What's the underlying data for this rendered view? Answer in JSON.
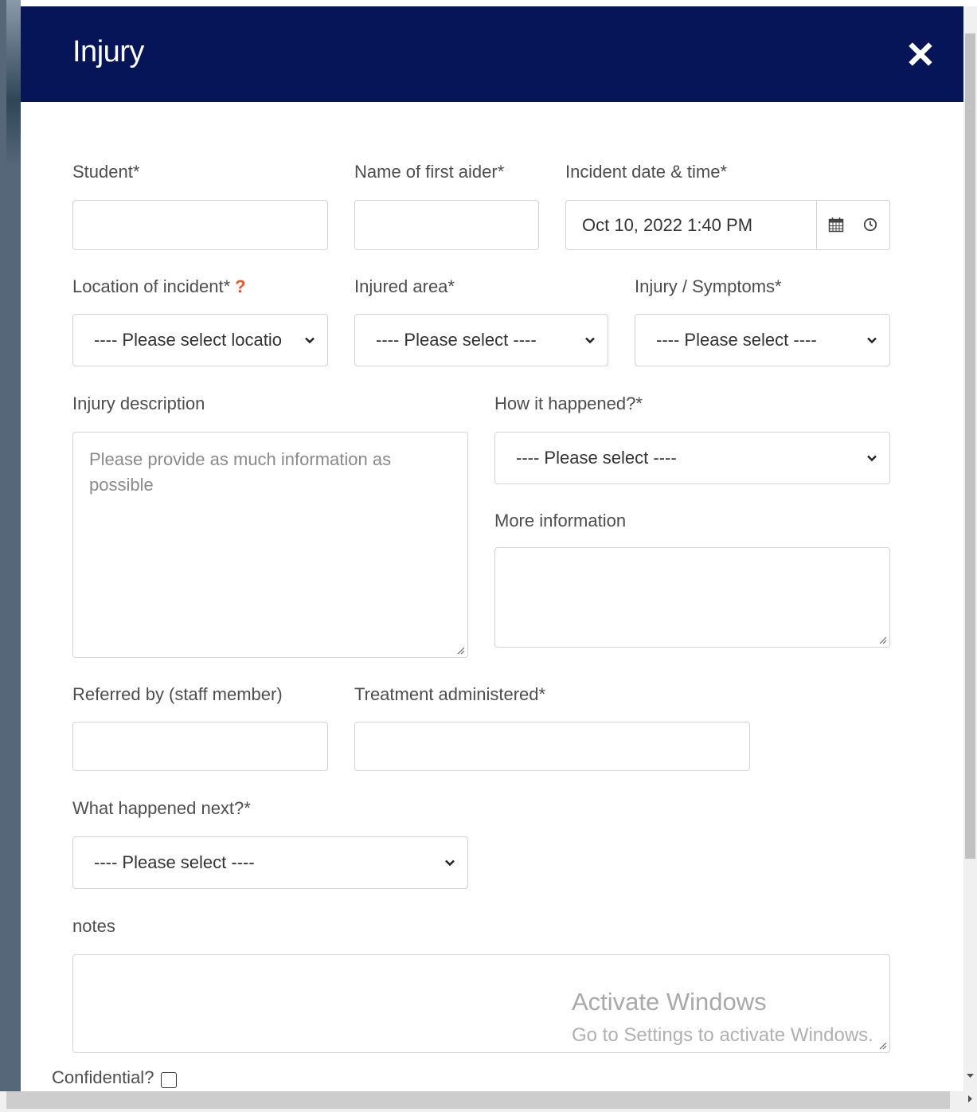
{
  "modal": {
    "title": "Injury"
  },
  "fields": {
    "student_label": "Student*",
    "first_aider_label": "Name of first aider*",
    "incident_datetime_label": "Incident date & time*",
    "incident_datetime_value": "Oct 10, 2022 1:40 PM",
    "location_label": "Location of incident*",
    "location_help": "?",
    "location_value": "---- Please select locatio",
    "injured_area_label": "Injured area*",
    "injured_area_value": "---- Please select ----",
    "symptoms_label": "Injury / Symptoms*",
    "symptoms_value": "---- Please select ----",
    "description_label": "Injury description",
    "description_placeholder": "Please provide as much information as possible",
    "how_label": "How it happened?*",
    "how_value": "---- Please select ----",
    "more_info_label": "More information",
    "referred_label": "Referred by (staff member)",
    "treatment_label": "Treatment administered*",
    "next_label": "What happened next?*",
    "next_value": "---- Please select ----",
    "notes_label": "notes",
    "confidential_label": "Confidential?"
  },
  "watermark": {
    "line1": "Activate Windows",
    "line2": "Go to Settings to activate Windows."
  },
  "colors": {
    "header": "#061458",
    "help": "#e8572f"
  }
}
